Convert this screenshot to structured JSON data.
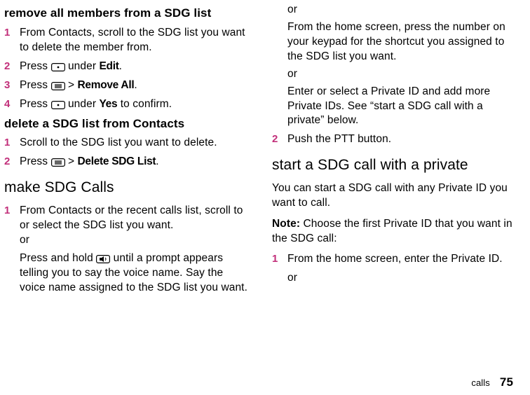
{
  "left": {
    "h1": "remove all members from a SDG list",
    "s1": {
      "n": "1",
      "t": "From Contacts, scroll to the SDG list you want to delete the member from."
    },
    "s2": {
      "n": "2",
      "a": "Press ",
      "b": " under ",
      "c": "Edit",
      "d": "."
    },
    "s3": {
      "n": "3",
      "a": "Press ",
      "b": " > ",
      "c": "Remove All",
      "d": "."
    },
    "s4": {
      "n": "4",
      "a": "Press ",
      "b": " under ",
      "c": "Yes",
      "d": " to confirm."
    },
    "h2": "delete a SDG list from Contacts",
    "s5": {
      "n": "1",
      "t": "Scroll to the SDG list you want to delete."
    },
    "s6": {
      "n": "2",
      "a": "Press ",
      "b": " > ",
      "c": "Delete SDG List",
      "d": "."
    },
    "h3": "make SDG Calls",
    "s7": {
      "n": "1",
      "t": "From Contacts or the recent calls list, scroll to or select the SDG list you want.",
      "or": "or"
    },
    "s7b_a": "Press and hold ",
    "s7b_b": " until a prompt appears telling you to say the voice name. Say the voice name assigned to the SDG list you want."
  },
  "right": {
    "or1": "or",
    "p1": "From the home screen, press the number on your keypad for the shortcut you assigned to the SDG list you want.",
    "or2": "or",
    "p2": "Enter or select a Private ID and add more Private IDs. See “start a SDG call with a private” below.",
    "s2": {
      "n": "2",
      "t": "Push the PTT button."
    },
    "h1": "start a SDG call with a private",
    "p3": "You can start a SDG call with any Private ID you want to call.",
    "noteLbl": "Note:",
    "noteTxt": " Choose the first Private ID that you want in the SDG call:",
    "s1": {
      "n": "1",
      "t": "From the home screen, enter the Private ID.",
      "or": "or"
    }
  },
  "footer": {
    "section": "calls",
    "page": "75"
  }
}
